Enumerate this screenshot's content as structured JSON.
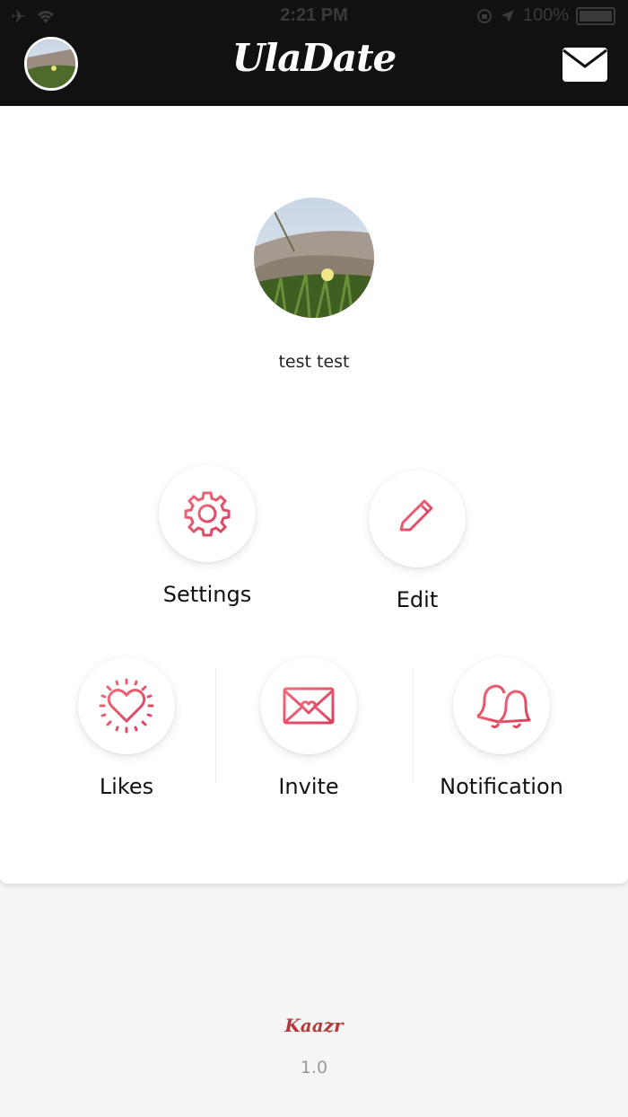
{
  "status_bar": {
    "time": "2:21 PM",
    "battery": "100%",
    "icons": [
      "airplane-icon",
      "wifi-icon",
      "orientation-lock-icon",
      "location-icon",
      "battery-icon"
    ]
  },
  "header": {
    "title": "UlaDate",
    "mail_icon": "envelope-icon"
  },
  "profile": {
    "name": "test test"
  },
  "actions": {
    "settings": "Settings",
    "edit": "Edit",
    "likes": "Likes",
    "invite": "Invite",
    "notification": "Notification"
  },
  "footer": {
    "brand": "Kaazr",
    "version": "1.0"
  },
  "colors": {
    "accent_start": "#e94b6b",
    "accent_end": "#d9556b",
    "header_bg": "#111111",
    "brand": "#b23a3a"
  }
}
